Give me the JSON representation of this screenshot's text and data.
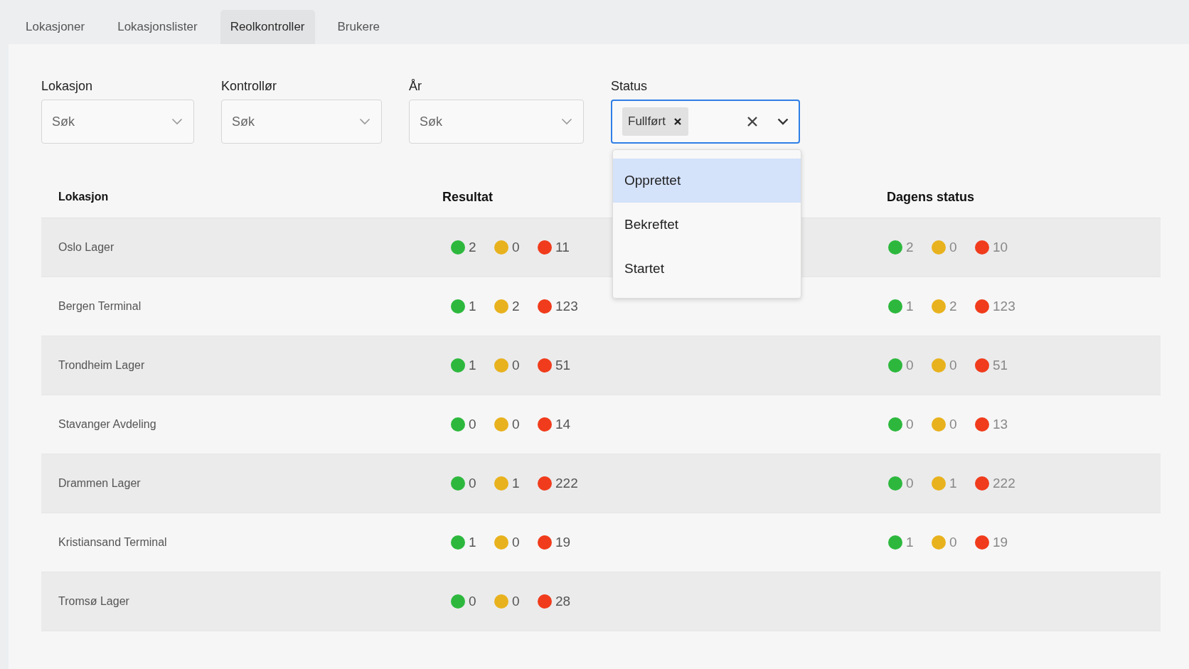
{
  "tabs": [
    {
      "label": "Lokasjoner",
      "selected": false
    },
    {
      "label": "Lokasjonslister",
      "selected": false
    },
    {
      "label": "Reolkontroller",
      "selected": true
    },
    {
      "label": "Brukere",
      "selected": false
    }
  ],
  "filters": [
    {
      "label": "Lokasjon",
      "placeholder": "Søk"
    },
    {
      "label": "Kontrollør",
      "placeholder": "Søk"
    },
    {
      "label": "År",
      "placeholder": "Søk"
    }
  ],
  "status_filter": {
    "label": "Status",
    "focused": true,
    "tags": [
      {
        "label": "Fullført"
      }
    ],
    "options": [
      {
        "label": "Opprettet",
        "highlighted": true
      },
      {
        "label": "Bekreftet",
        "highlighted": false
      },
      {
        "label": "Startet",
        "highlighted": false
      }
    ]
  },
  "table": {
    "columns": [
      "Lokasjon",
      "Resultat",
      "Dagens status"
    ],
    "rows": [
      {
        "location": "Oslo Lager",
        "result": [
          {
            "color": "#2db83d",
            "count": "2"
          },
          {
            "color": "#e8b21e",
            "count": "0"
          },
          {
            "color": "#f03c1c",
            "count": "11"
          }
        ],
        "todays_status": [
          {
            "color": "#2db83d",
            "count": "2"
          },
          {
            "color": "#e8b21e",
            "count": "0"
          },
          {
            "color": "#f03c1c",
            "count": "10"
          }
        ]
      },
      {
        "location": "Bergen Terminal",
        "result": [
          {
            "color": "#2db83d",
            "count": "1"
          },
          {
            "color": "#e8b21e",
            "count": "2"
          },
          {
            "color": "#f03c1c",
            "count": "123"
          }
        ],
        "todays_status": [
          {
            "color": "#2db83d",
            "count": "1"
          },
          {
            "color": "#e8b21e",
            "count": "2"
          },
          {
            "color": "#f03c1c",
            "count": "123"
          }
        ]
      },
      {
        "location": "Trondheim Lager",
        "result": [
          {
            "color": "#2db83d",
            "count": "1"
          },
          {
            "color": "#e8b21e",
            "count": "0"
          },
          {
            "color": "#f03c1c",
            "count": "51"
          }
        ],
        "todays_status": [
          {
            "color": "#2db83d",
            "count": "0"
          },
          {
            "color": "#e8b21e",
            "count": "0"
          },
          {
            "color": "#f03c1c",
            "count": "51"
          }
        ]
      },
      {
        "location": "Stavanger Avdeling",
        "result": [
          {
            "color": "#2db83d",
            "count": "0"
          },
          {
            "color": "#e8b21e",
            "count": "0"
          },
          {
            "color": "#f03c1c",
            "count": "14"
          }
        ],
        "todays_status": [
          {
            "color": "#2db83d",
            "count": "0"
          },
          {
            "color": "#e8b21e",
            "count": "0"
          },
          {
            "color": "#f03c1c",
            "count": "13"
          }
        ]
      },
      {
        "location": "Drammen Lager",
        "result": [
          {
            "color": "#2db83d",
            "count": "0"
          },
          {
            "color": "#e8b21e",
            "count": "1"
          },
          {
            "color": "#f03c1c",
            "count": "222"
          }
        ],
        "todays_status": [
          {
            "color": "#2db83d",
            "count": "0"
          },
          {
            "color": "#e8b21e",
            "count": "1"
          },
          {
            "color": "#f03c1c",
            "count": "222"
          }
        ]
      },
      {
        "location": "Kristiansand Terminal",
        "result": [
          {
            "color": "#2db83d",
            "count": "1"
          },
          {
            "color": "#e8b21e",
            "count": "0"
          },
          {
            "color": "#f03c1c",
            "count": "19"
          }
        ],
        "todays_status": [
          {
            "color": "#2db83d",
            "count": "1"
          },
          {
            "color": "#e8b21e",
            "count": "0"
          },
          {
            "color": "#f03c1c",
            "count": "19"
          }
        ]
      },
      {
        "location": "Tromsø Lager",
        "result": [
          {
            "color": "#2db83d",
            "count": "0"
          },
          {
            "color": "#e8b21e",
            "count": "0"
          },
          {
            "color": "#f03c1c",
            "count": "28"
          }
        ]
      }
    ]
  }
}
